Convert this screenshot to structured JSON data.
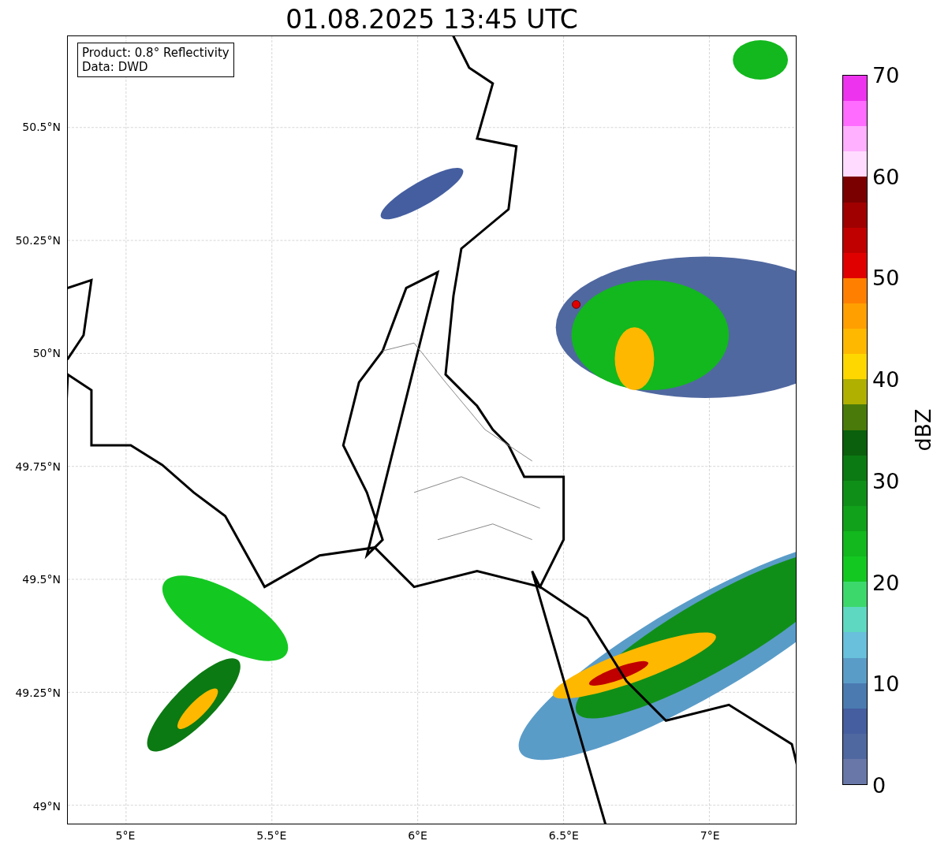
{
  "title": "01.08.2025 13:45 UTC",
  "info_box": [
    "Product: 0.8° Reflectivity",
    "Data: DWD"
  ],
  "latitude_ticks": [
    "50.5°N",
    "50.25°N",
    "50°N",
    "49.75°N",
    "49.5°N",
    "49.25°N",
    "49°N"
  ],
  "longitude_ticks": [
    "5°E",
    "5.5°E",
    "6°E",
    "6.5°E",
    "7°E"
  ],
  "colorbar": {
    "label": "dBZ",
    "ticks": [
      "70",
      "60",
      "50",
      "40",
      "30",
      "20",
      "10",
      "0"
    ],
    "bins": [
      {
        "color": "#ee33ee"
      },
      {
        "color": "#ff6cff"
      },
      {
        "color": "#ffb0ff"
      },
      {
        "color": "#ffdcff"
      },
      {
        "color": "#7a0000"
      },
      {
        "color": "#a00000"
      },
      {
        "color": "#c00000"
      },
      {
        "color": "#e00000"
      },
      {
        "color": "#ff8000"
      },
      {
        "color": "#ff9f00"
      },
      {
        "color": "#ffb800"
      },
      {
        "color": "#ffd700"
      },
      {
        "color": "#b0b000"
      },
      {
        "color": "#4a7a0a"
      },
      {
        "color": "#0a600c"
      },
      {
        "color": "#0b7a12"
      },
      {
        "color": "#108f18"
      },
      {
        "color": "#11a11a"
      },
      {
        "color": "#12b81d"
      },
      {
        "color": "#14c822"
      },
      {
        "color": "#3cd86c"
      },
      {
        "color": "#5ed8c0"
      },
      {
        "color": "#68c0dc"
      },
      {
        "color": "#5a9cc8"
      },
      {
        "color": "#4a7ab0"
      },
      {
        "color": "#445ea0"
      },
      {
        "color": "#5068a0"
      },
      {
        "color": "#6877a8"
      }
    ]
  }
}
